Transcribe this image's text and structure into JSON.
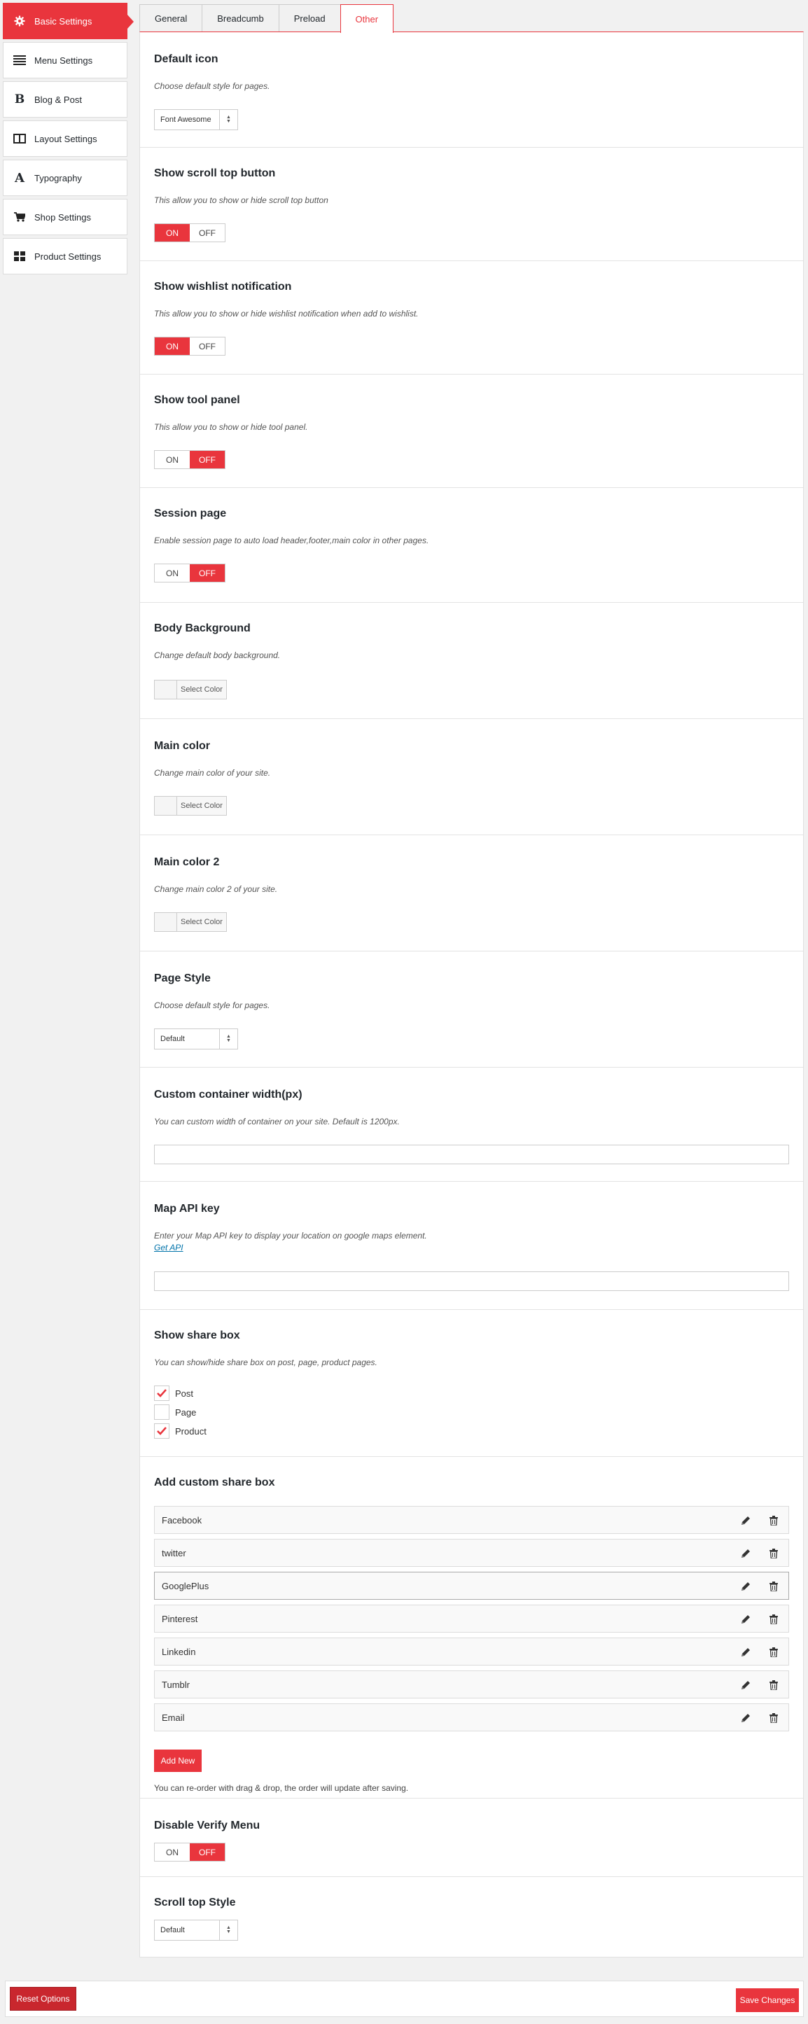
{
  "sidebar": {
    "items": [
      {
        "label": "Basic Settings",
        "icon": "gear-icon"
      },
      {
        "label": "Menu Settings",
        "icon": "menu-lines-icon"
      },
      {
        "label": "Blog & Post",
        "icon": "bold-b-icon"
      },
      {
        "label": "Layout Settings",
        "icon": "layout-columns-icon"
      },
      {
        "label": "Typography",
        "icon": "typography-a-icon"
      },
      {
        "label": "Shop Settings",
        "icon": "cart-icon"
      },
      {
        "label": "Product Settings",
        "icon": "grid-icon"
      }
    ]
  },
  "tabs": [
    {
      "label": "General"
    },
    {
      "label": "Breadcumb"
    },
    {
      "label": "Preload"
    },
    {
      "label": "Other"
    }
  ],
  "sections": {
    "default_icon": {
      "title": "Default icon",
      "desc": "Choose default style for pages.",
      "value": "Font Awesome"
    },
    "scroll_top": {
      "title": "Show scroll top button",
      "desc": "This allow you to show or hide scroll top button",
      "state": "ON"
    },
    "wishlist": {
      "title": "Show wishlist notification",
      "desc": "This allow you to show or hide wishlist notification when add to wishlist.",
      "state": "ON"
    },
    "tool_panel": {
      "title": "Show tool panel",
      "desc": "This allow you to show or hide tool panel.",
      "state": "OFF"
    },
    "session_page": {
      "title": "Session page",
      "desc": "Enable session page to auto load header,footer,main color in other pages.",
      "state": "OFF"
    },
    "body_bg": {
      "title": "Body Background",
      "desc": "Change default body background.",
      "button": "Select Color"
    },
    "main_color": {
      "title": "Main color",
      "desc": "Change main color of your site.",
      "button": "Select Color"
    },
    "main_color2": {
      "title": "Main color 2",
      "desc": "Change main color 2 of your site.",
      "button": "Select Color"
    },
    "page_style": {
      "title": "Page Style",
      "desc": "Choose default style for pages.",
      "value": "Default"
    },
    "container_width": {
      "title": "Custom container width(px)",
      "desc": "You can custom width of container on your site. Default is 1200px.",
      "value": ""
    },
    "map_api": {
      "title": "Map API key",
      "desc": "Enter your Map API key to display your location on google maps element.",
      "link": "Get API",
      "value": ""
    },
    "share_box": {
      "title": "Show share box",
      "desc": "You can show/hide share box on post, page, product pages.",
      "options": [
        {
          "label": "Post",
          "checked": true
        },
        {
          "label": "Page",
          "checked": false
        },
        {
          "label": "Product",
          "checked": true
        }
      ]
    },
    "custom_share": {
      "title": "Add custom share box",
      "items": [
        "Facebook",
        "twitter",
        "GooglePlus",
        "Pinterest",
        "Linkedin",
        "Tumblr",
        "Email"
      ],
      "add_label": "Add New",
      "note": "You can re-order with drag & drop, the order will update after saving."
    },
    "verify_menu": {
      "title": "Disable Verify Menu",
      "state": "OFF"
    },
    "scroll_style": {
      "title": "Scroll top Style",
      "value": "Default"
    }
  },
  "toggle_labels": {
    "on": "ON",
    "off": "OFF"
  },
  "footer": {
    "reset_label": "Reset Options",
    "save_label": "Save Changes"
  },
  "colors": {
    "accent": "#e9353d",
    "reset": "#c9272e"
  }
}
